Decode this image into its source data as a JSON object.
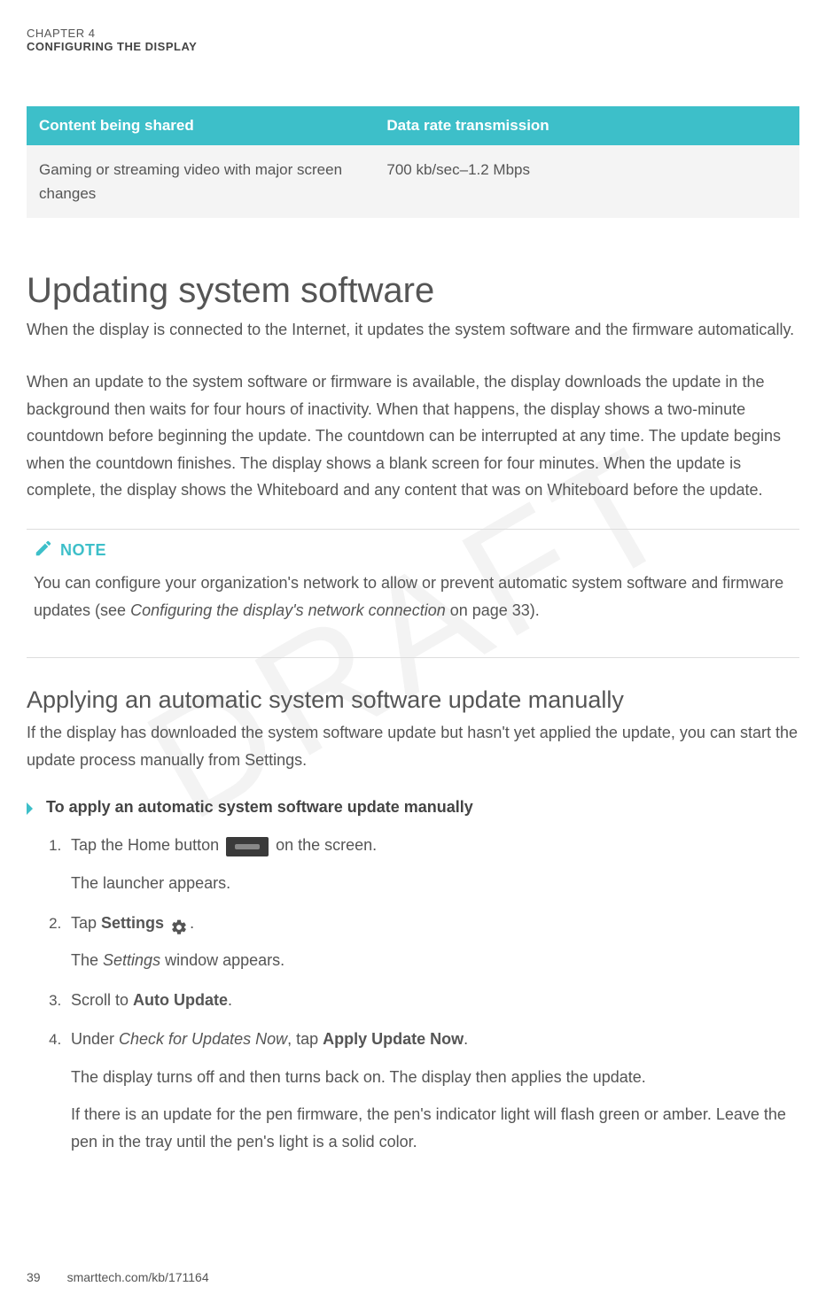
{
  "header": {
    "chapter_label": "CHAPTER 4",
    "chapter_title": "CONFIGURING THE DISPLAY"
  },
  "watermark": "DRAFT",
  "table": {
    "headers": [
      "Content being shared",
      "Data rate transmission"
    ],
    "rows": [
      {
        "c0": "Gaming or streaming video with major screen changes",
        "c1": "700 kb/sec–1.2 Mbps"
      }
    ]
  },
  "section": {
    "title": "Updating system software",
    "intro": "When the display is connected to the Internet, it updates the system software and the firmware automatically.",
    "para": "When an update to the system software or firmware is available, the display downloads the update in the background then waits for four hours of inactivity. When that happens, the display shows a two-minute countdown before beginning the update. The countdown can be interrupted at any time. The update begins when the countdown finishes. The display shows a blank screen for four minutes. When the update is complete, the display shows the Whiteboard and any content that was on Whiteboard before the update."
  },
  "note": {
    "label": "NOTE",
    "text_pre": "You can configure your organization's network to allow or prevent automatic system software and firmware updates (see ",
    "text_italic": "Configuring the display's network connection",
    "text_post": " on page 33)."
  },
  "subsection": {
    "title": "Applying an automatic system software update manually",
    "intro": "If the display has downloaded the system software update but hasn't yet applied the update, you can start the update process manually from Settings."
  },
  "procedure": {
    "title": "To apply an automatic system software update manually",
    "steps": {
      "s1_pre": "Tap the Home button ",
      "s1_post": " on the screen.",
      "s1_sub": "The launcher appears.",
      "s2_pre": "Tap ",
      "s2_bold": "Settings",
      "s2_post": ".",
      "s2_sub_pre": "The ",
      "s2_sub_italic": "Settings",
      "s2_sub_post": " window appears.",
      "s3_pre": "Scroll to ",
      "s3_bold": "Auto Update",
      "s3_post": ".",
      "s4_pre": "Under ",
      "s4_italic": "Check for Updates Now",
      "s4_mid": ", tap ",
      "s4_bold": "Apply Update Now",
      "s4_post": ".",
      "s4_sub1": "The display turns off and then turns back on. The display then applies the update.",
      "s4_sub2": "If there is an update for the pen firmware, the pen's indicator light will flash green or amber. Leave the pen in the tray until the pen's light is a solid color."
    }
  },
  "footer": {
    "page": "39",
    "url": "smarttech.com/kb/171164"
  }
}
